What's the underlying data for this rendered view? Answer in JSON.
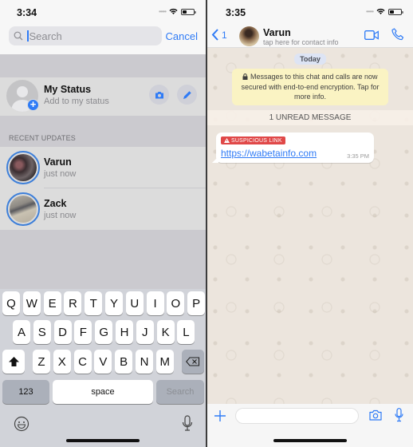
{
  "left_screen": {
    "status_bar": {
      "time": "3:34",
      "signal_icon": "signal-dots-icon",
      "wifi_icon": "wifi-icon",
      "battery_icon": "battery-icon"
    },
    "search": {
      "placeholder": "Search",
      "value": "",
      "cancel_label": "Cancel"
    },
    "my_status": {
      "title": "My Status",
      "subtitle": "Add to my status",
      "camera_button": "camera-icon",
      "edit_button": "pencil-icon",
      "add_badge": "+"
    },
    "recent_updates_label": "RECENT UPDATES",
    "recent_updates": [
      {
        "name": "Varun",
        "time": "just now"
      },
      {
        "name": "Zack",
        "time": "just now"
      }
    ],
    "keyboard": {
      "row1": [
        "Q",
        "W",
        "E",
        "R",
        "T",
        "Y",
        "U",
        "I",
        "O",
        "P"
      ],
      "row2": [
        "A",
        "S",
        "D",
        "F",
        "G",
        "H",
        "J",
        "K",
        "L"
      ],
      "row3": [
        "Z",
        "X",
        "C",
        "V",
        "B",
        "N",
        "M"
      ],
      "numbers_label": "123",
      "space_label": "space",
      "return_label": "Search"
    }
  },
  "right_screen": {
    "status_bar": {
      "time": "3:35"
    },
    "header": {
      "back_count": "1",
      "contact_name": "Varun",
      "contact_subtitle": "tap here for contact info"
    },
    "date_label": "Today",
    "encryption_notice": "Messages to this chat and calls are now secured with end-to-end encryption. Tap for more info.",
    "unread_banner": "1 UNREAD MESSAGE",
    "messages": [
      {
        "warning_label": "SUSPICIOUS LINK",
        "text": "https://wabetainfo.com",
        "time": "3:35 PM",
        "direction": "incoming"
      }
    ],
    "composer": {
      "value": "",
      "placeholder": ""
    }
  },
  "colors": {
    "accent": "#2f7bf6",
    "warning": "#e04848",
    "notice_bg": "#faf3c3",
    "chat_bg": "#ece5dd"
  }
}
